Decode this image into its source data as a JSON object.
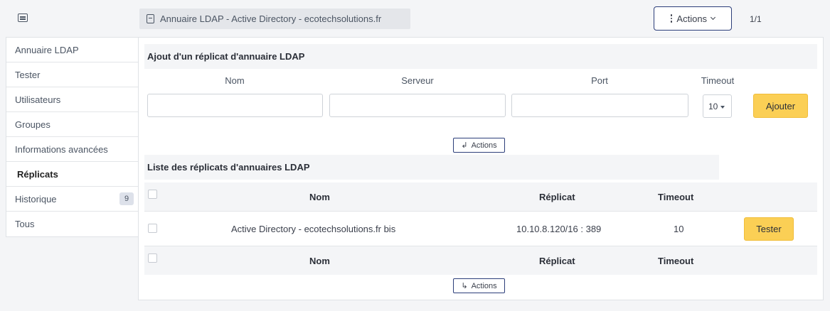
{
  "header": {
    "title": "Annuaire LDAP - Active Directory - ecotechsolutions.fr",
    "actions_label": "Actions",
    "pager": "1/1"
  },
  "sidebar": {
    "items": [
      {
        "label": "Annuaire LDAP"
      },
      {
        "label": "Tester"
      },
      {
        "label": "Utilisateurs"
      },
      {
        "label": "Groupes"
      },
      {
        "label": "Informations avancées"
      },
      {
        "label": "Réplicats",
        "active": true
      },
      {
        "label": "Historique",
        "badge": "9"
      },
      {
        "label": "Tous"
      }
    ]
  },
  "add_form": {
    "title": "Ajout d'un réplicat d'annuaire LDAP",
    "columns": {
      "nom": "Nom",
      "serveur": "Serveur",
      "port": "Port",
      "timeout": "Timeout"
    },
    "values": {
      "nom": "",
      "serveur": "",
      "port": ""
    },
    "timeout_selected": "10",
    "submit_label": "Ajouter"
  },
  "mass_actions": {
    "label": "Actions"
  },
  "list": {
    "title": "Liste des réplicats d'annuaires LDAP",
    "columns": {
      "nom": "Nom",
      "replicat": "Réplicat",
      "timeout": "Timeout"
    },
    "rows": [
      {
        "nom": "Active Directory - ecotechsolutions.fr bis",
        "replicat": "10.10.8.120/16 : 389",
        "timeout": "10",
        "action": "Tester"
      }
    ]
  },
  "colors": {
    "accent": "#2c3e7a",
    "button_yellow": "#fbcf55",
    "panel_bg": "#f4f5f7"
  }
}
